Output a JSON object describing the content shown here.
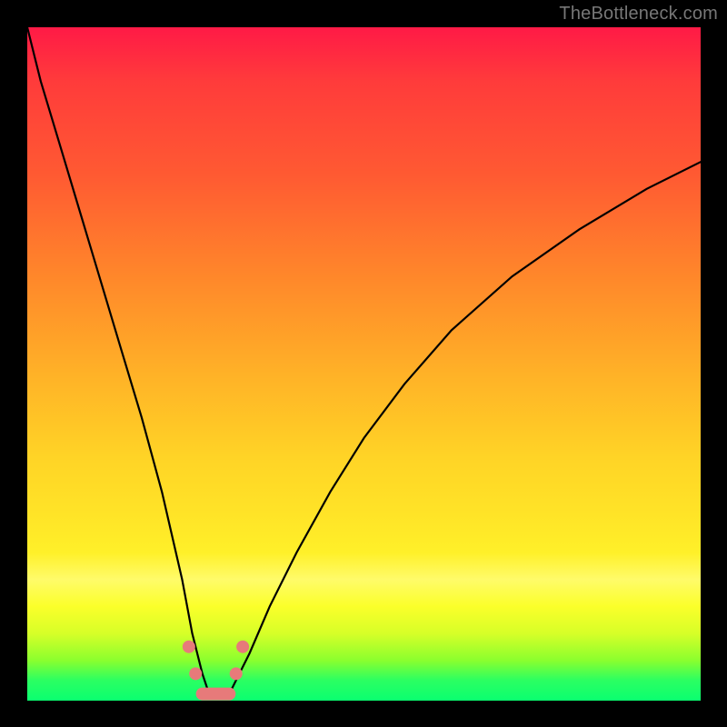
{
  "watermark": "TheBottleneck.com",
  "colors": {
    "page_bg": "#000000",
    "marker": "#e77a7a",
    "curve": "#000000",
    "gradient_top": "#ff1a46",
    "gradient_bottom": "#0aff70"
  },
  "chart_data": {
    "type": "line",
    "title": "",
    "xlabel": "",
    "ylabel": "",
    "xlim": [
      0,
      100
    ],
    "ylim": [
      0,
      100
    ],
    "note": "Axes are unlabeled; values below are estimated from pixel positions on a 0–100 normalized grid. The curve is a steep V dip to ~0 near x≈27 then rises with diminishing slope toward the right edge. Small salmon markers cluster around the trough.",
    "series": [
      {
        "name": "bottleneck-curve",
        "x": [
          0,
          2,
          5,
          8,
          11,
          14,
          17,
          20,
          23,
          24.5,
          26,
          27,
          28,
          29,
          30,
          31,
          33,
          36,
          40,
          45,
          50,
          56,
          63,
          72,
          82,
          92,
          100
        ],
        "y": [
          100,
          92,
          82,
          72,
          62,
          52,
          42,
          31,
          18,
          10,
          4,
          1,
          0.5,
          0.5,
          1,
          3,
          7,
          14,
          22,
          31,
          39,
          47,
          55,
          63,
          70,
          76,
          80
        ]
      }
    ],
    "markers": [
      {
        "name": "trough-left-dot-1",
        "x": 24.0,
        "y": 8.0
      },
      {
        "name": "trough-left-dot-2",
        "x": 25.0,
        "y": 4.0
      },
      {
        "name": "trough-bar",
        "x0": 26.0,
        "x1": 30.0,
        "y": 1.0
      },
      {
        "name": "trough-right-dot-1",
        "x": 31.0,
        "y": 4.0
      },
      {
        "name": "trough-right-dot-2",
        "x": 32.0,
        "y": 8.0
      }
    ]
  }
}
